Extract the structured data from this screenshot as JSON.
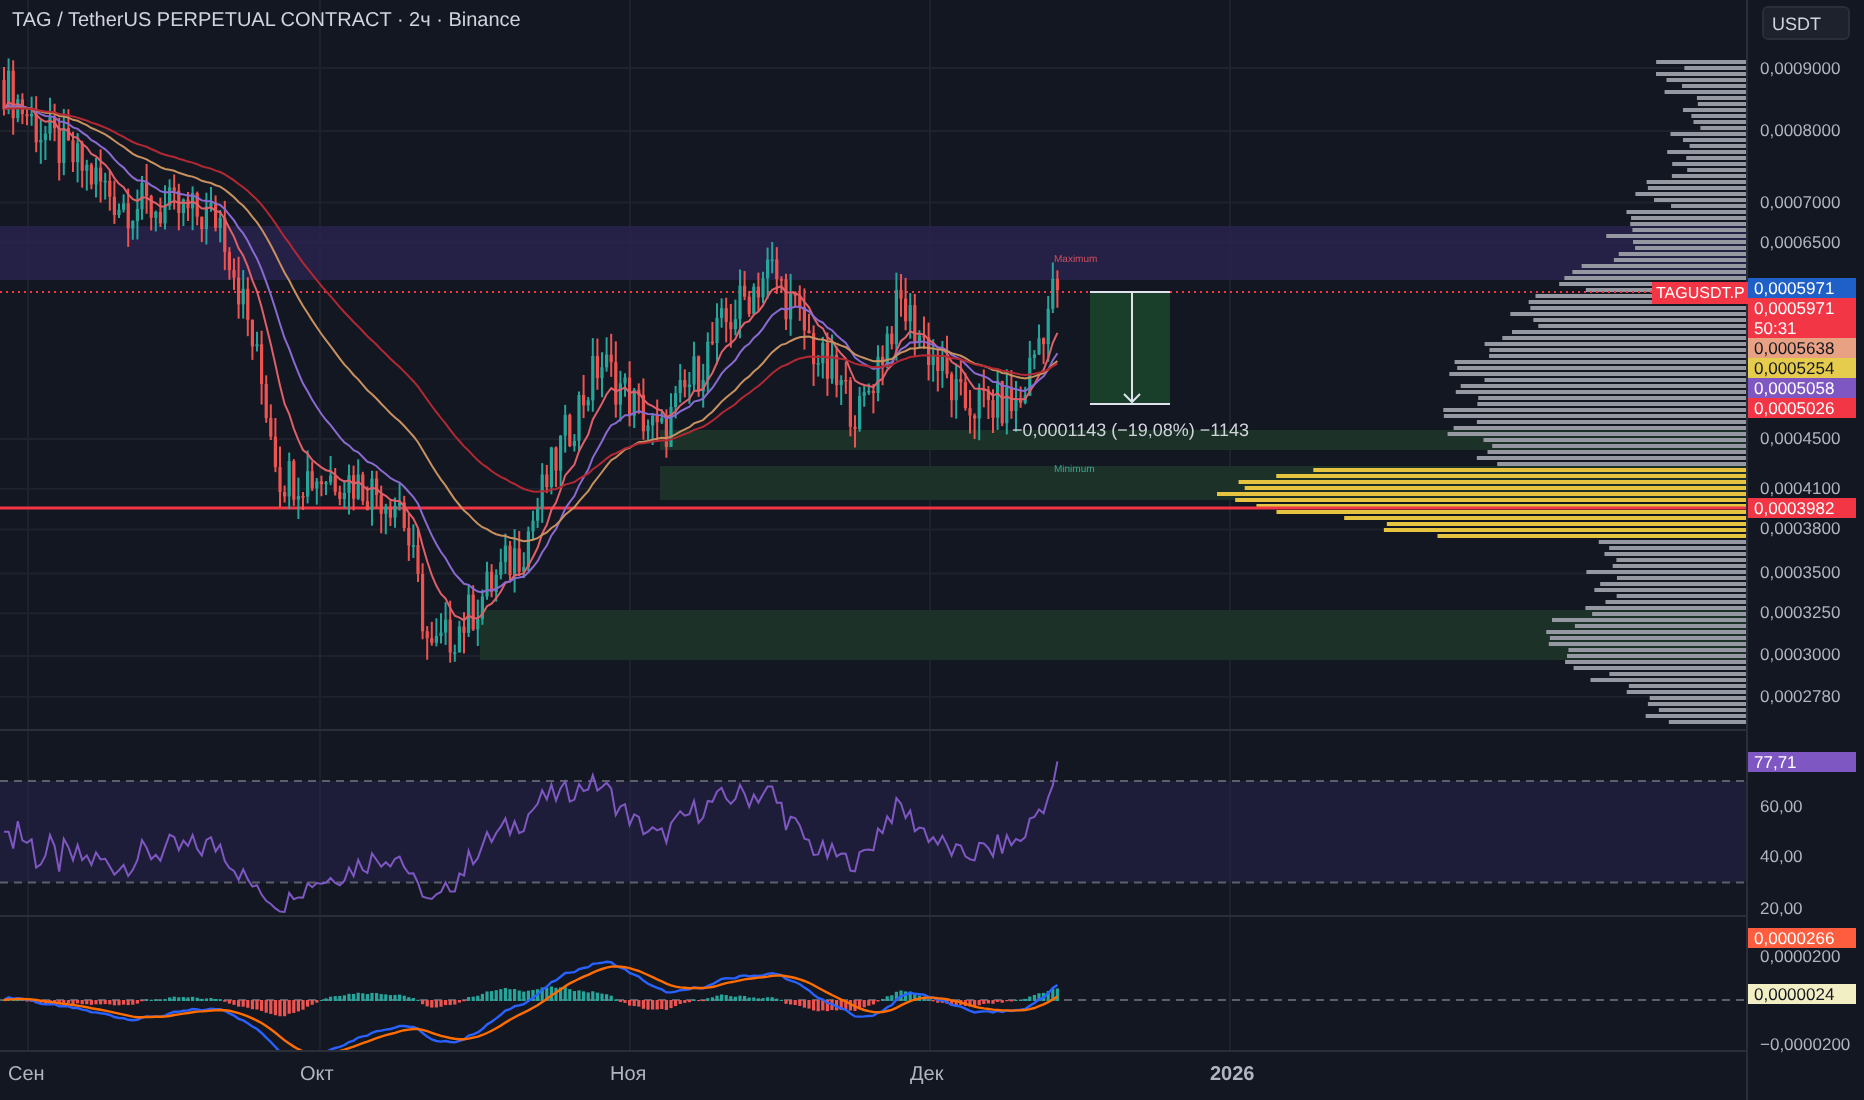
{
  "title": "TAG / TetherUS PERPETUAL CONTRACT · 2ч · Binance",
  "currency_button": "USDT",
  "price_ticks": [
    "0,0009000",
    "0,0008000",
    "0,0007000",
    "0,0006500",
    "0,0004500",
    "0,0004100",
    "0,0003800",
    "0,0003500",
    "0,0003250",
    "0,0003000",
    "0,0002780"
  ],
  "price_labels": [
    {
      "text": "0,0005971",
      "color": "#1e5fc8"
    },
    {
      "text": "0,0005971",
      "sub": "50:31",
      "color": "#f23645"
    },
    {
      "text": "0,0005638",
      "color": "#e8a283"
    },
    {
      "text": "0,0005254",
      "color": "#e6cc4c"
    },
    {
      "text": "0,0005058",
      "color": "#7e57c2"
    },
    {
      "text": "0,0005026",
      "color": "#f23645"
    },
    {
      "text": "0,0003982",
      "color": "#f23645"
    }
  ],
  "symbol_tag": "TAGUSDT.P",
  "chart_labels": {
    "maximum": "Maximum",
    "minimum": "Minimum"
  },
  "measure": "−0,0001143 (−19,08%) −1143",
  "rsi_ticks": [
    "60,00",
    "40,00",
    "20,00"
  ],
  "rsi_label": {
    "text": "77,71",
    "color": "#7e57c2"
  },
  "macd_ticks": [
    "0,0000200",
    "−0,0000200"
  ],
  "macd_labels": [
    {
      "text": "0,0000266",
      "color": "#ff5d3d"
    },
    {
      "text": "0,0000024",
      "color": "#f3efc4"
    }
  ],
  "x_labels": [
    {
      "text": "Сен",
      "bold": false
    },
    {
      "text": "Окт",
      "bold": false
    },
    {
      "text": "Ноя",
      "bold": false
    },
    {
      "text": "Дек",
      "bold": false
    },
    {
      "text": "2026",
      "bold": true
    }
  ]
}
